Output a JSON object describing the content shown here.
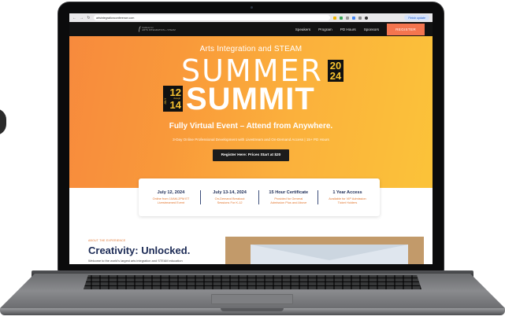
{
  "browser": {
    "back_icon": "←",
    "forward_icon": "→",
    "reload_icon": "↻",
    "url": "artsintegrationconference.com",
    "update_button": "Finish update"
  },
  "site_nav": {
    "logo_mark": "f",
    "logo_line1": "Institute for",
    "logo_line2": "ARTS INTEGRATION + STEAM",
    "links": [
      "Speakers",
      "Program",
      "PD Hours",
      "Sponsors"
    ],
    "register_label": "REGISTER",
    "register_color": "#f4754f"
  },
  "hero": {
    "eyebrow": "Arts Integration and STEAM",
    "summer_word": "SUMMER",
    "year_top": "20",
    "year_bottom": "24",
    "month_label": "JULY",
    "day_start": "12",
    "through_label": "through",
    "day_end": "14",
    "summit_word": "SUMMIT",
    "tagline": "Fully Virtual Event – Attend from Anywhere.",
    "subtitle": "3-Day Online Professional Development with Livestream and On-Demand Access | 15+ PD Hours",
    "cta_label": "Register Here: Prices Start at $20",
    "gradient_start": "#f78a3d",
    "gradient_end": "#fbc339"
  },
  "info_items": [
    {
      "title": "July 12, 2024",
      "line1": "Online from 10AM-2PM ET",
      "line2": "Livestreamed Event"
    },
    {
      "title": "July 13-14, 2024",
      "line1": "On-Demand Breakout",
      "line2": "Sessions For K-12"
    },
    {
      "title": "15 Hour Certificate",
      "line1": "Provided for General",
      "line2": "Admission Plus and Above"
    },
    {
      "title": "1 Year Access",
      "line1": "Available for VIP Admission",
      "line2": "Ticket Holders"
    }
  ],
  "about": {
    "eyebrow": "ABOUT THE EXPERIENCE",
    "heading": "Creativity: Unlocked.",
    "body": "Welcome to the world's largest arts integration and STEAM education"
  }
}
